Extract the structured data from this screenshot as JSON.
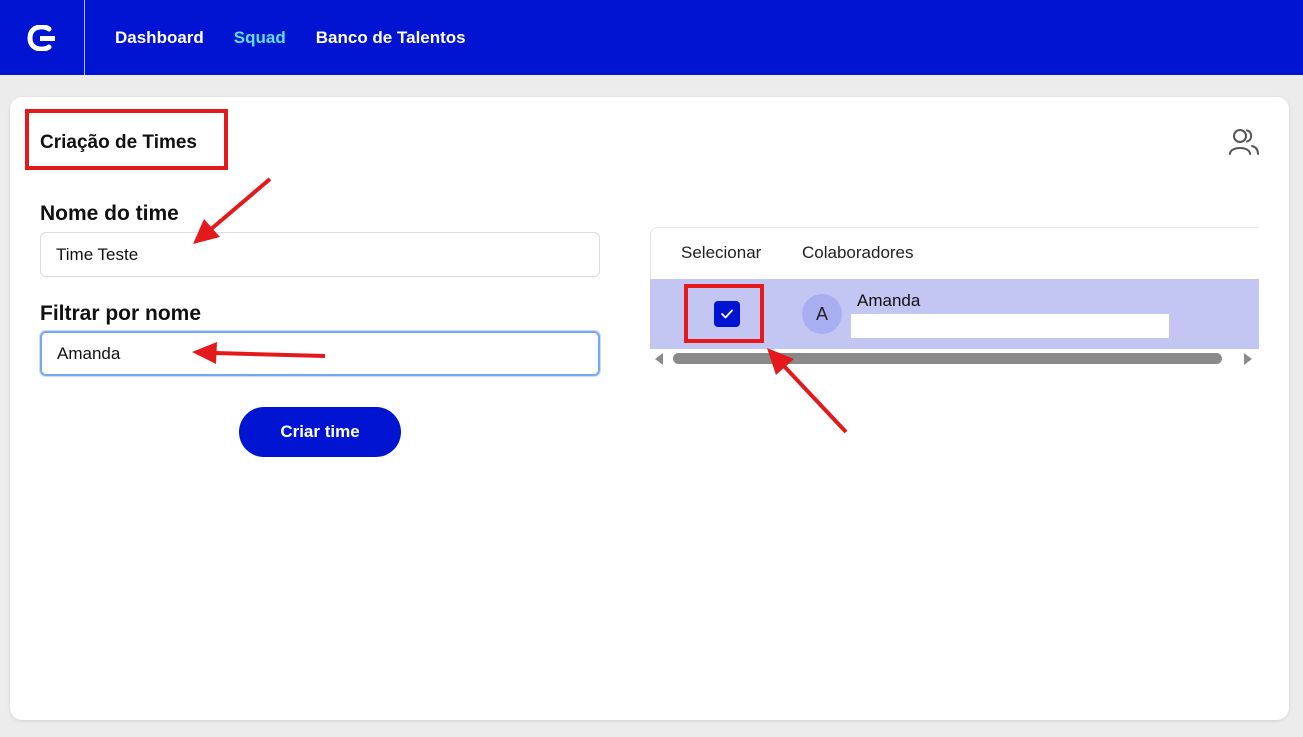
{
  "nav": {
    "logo_icon": "brand-logo-icon",
    "items": [
      {
        "label": "Dashboard",
        "active": false
      },
      {
        "label": "Squad",
        "active": true
      },
      {
        "label": "Banco de Talentos",
        "active": false
      }
    ]
  },
  "page": {
    "title": "Criação de Times",
    "team_icon": "users-icon"
  },
  "form": {
    "team_name_label": "Nome do time",
    "team_name_value": "Time Teste",
    "filter_label": "Filtrar por nome",
    "filter_value": "Amanda",
    "submit_label": "Criar time"
  },
  "table": {
    "headers": [
      "Selecionar",
      "Colaboradores"
    ],
    "rows": [
      {
        "selected": true,
        "avatar_initial": "A",
        "name": "Amanda"
      }
    ]
  },
  "colors": {
    "primary": "#0014d1",
    "nav_active": "#5ce1f0",
    "row_selected": "#c3c6f3",
    "annotation": "#e3191c"
  }
}
